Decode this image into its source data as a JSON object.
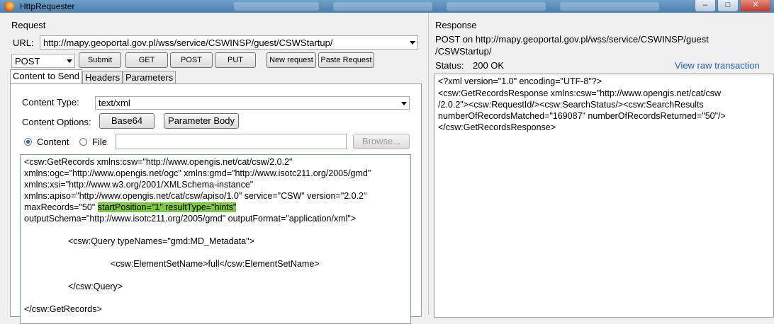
{
  "window": {
    "title": "HttpRequester"
  },
  "request": {
    "section_label": "Request",
    "url_label": "URL:",
    "url_value": "http://mapy.geoportal.gov.pl/wss/service/CSWINSP/guest/CSWStartup/",
    "method": "POST",
    "buttons": {
      "submit": "Submit",
      "get": "GET",
      "post": "POST",
      "put": "PUT",
      "new_request": "New request",
      "paste_request": "Paste Request"
    },
    "tabs": [
      "Content to Send",
      "Headers",
      "Parameters"
    ],
    "content_type_label": "Content Type:",
    "content_type_value": "text/xml",
    "content_options_label": "Content Options:",
    "base64_label": "Base64",
    "parameter_body_label": "Parameter Body",
    "radio_content": "Content",
    "radio_file": "File",
    "browse_label": "Browse...",
    "body": {
      "line1": "<csw:GetRecords xmlns:csw=\"http://www.opengis.net/cat/csw/2.0.2\"",
      "line2": "xmlns:ogc=\"http://www.opengis.net/ogc\" xmlns:gmd=\"http://www.isotc211.org/2005/gmd\"",
      "line3": "xmlns:xsi=\"http://www.w3.org/2001/XMLSchema-instance\"",
      "line4": "xmlns:apiso=\"http://www.opengis.net/cat/csw/apiso/1.0\" service=\"CSW\" version=\"2.0.2\"",
      "line5a": "maxRecords=\"50\" ",
      "line5b": "startPosition=\"1\" resultType=\"hints\" ",
      "line6": "outputSchema=\"http://www.isotc211.org/2005/gmd\" outputFormat=\"application/xml\">",
      "line7": "<csw:Query typeNames=\"gmd:MD_Metadata\">",
      "line8": "<csw:ElementSetName>full</csw:ElementSetName>",
      "line9": "</csw:Query>",
      "line10": "</csw:GetRecords>"
    }
  },
  "response": {
    "section_label": "Response",
    "post_line1": "POST on http://mapy.geoportal.gov.pl/wss/service/CSWINSP/guest",
    "post_line2": "/CSWStartup/",
    "status_label": "Status:",
    "status_value": "200 OK",
    "view_raw": "View raw transaction",
    "body": {
      "line1": "<?xml version=\"1.0\" encoding=\"UTF-8\"?>",
      "line2": "<csw:GetRecordsResponse xmlns:csw=\"http://www.opengis.net/cat/csw",
      "line3": "/2.0.2\"><csw:RequestId/><csw:SearchStatus/><csw:SearchResults",
      "line4": "numberOfRecordsMatched=\"169087\" numberOfRecordsReturned=\"50\"/>",
      "line5": "</csw:GetRecordsResponse>"
    }
  }
}
